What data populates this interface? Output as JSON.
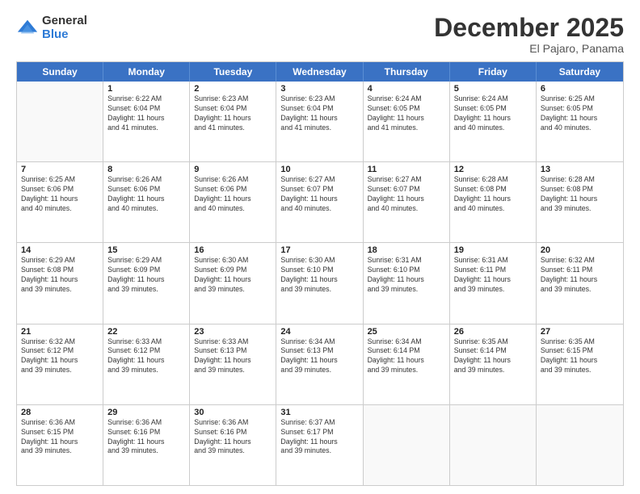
{
  "logo": {
    "general": "General",
    "blue": "Blue"
  },
  "title": "December 2025",
  "location": "El Pajaro, Panama",
  "days": [
    "Sunday",
    "Monday",
    "Tuesday",
    "Wednesday",
    "Thursday",
    "Friday",
    "Saturday"
  ],
  "weeks": [
    [
      {
        "day": "",
        "info": ""
      },
      {
        "day": "1",
        "info": "Sunrise: 6:22 AM\nSunset: 6:04 PM\nDaylight: 11 hours\nand 41 minutes."
      },
      {
        "day": "2",
        "info": "Sunrise: 6:23 AM\nSunset: 6:04 PM\nDaylight: 11 hours\nand 41 minutes."
      },
      {
        "day": "3",
        "info": "Sunrise: 6:23 AM\nSunset: 6:04 PM\nDaylight: 11 hours\nand 41 minutes."
      },
      {
        "day": "4",
        "info": "Sunrise: 6:24 AM\nSunset: 6:05 PM\nDaylight: 11 hours\nand 41 minutes."
      },
      {
        "day": "5",
        "info": "Sunrise: 6:24 AM\nSunset: 6:05 PM\nDaylight: 11 hours\nand 40 minutes."
      },
      {
        "day": "6",
        "info": "Sunrise: 6:25 AM\nSunset: 6:05 PM\nDaylight: 11 hours\nand 40 minutes."
      }
    ],
    [
      {
        "day": "7",
        "info": "Sunrise: 6:25 AM\nSunset: 6:06 PM\nDaylight: 11 hours\nand 40 minutes."
      },
      {
        "day": "8",
        "info": "Sunrise: 6:26 AM\nSunset: 6:06 PM\nDaylight: 11 hours\nand 40 minutes."
      },
      {
        "day": "9",
        "info": "Sunrise: 6:26 AM\nSunset: 6:06 PM\nDaylight: 11 hours\nand 40 minutes."
      },
      {
        "day": "10",
        "info": "Sunrise: 6:27 AM\nSunset: 6:07 PM\nDaylight: 11 hours\nand 40 minutes."
      },
      {
        "day": "11",
        "info": "Sunrise: 6:27 AM\nSunset: 6:07 PM\nDaylight: 11 hours\nand 40 minutes."
      },
      {
        "day": "12",
        "info": "Sunrise: 6:28 AM\nSunset: 6:08 PM\nDaylight: 11 hours\nand 40 minutes."
      },
      {
        "day": "13",
        "info": "Sunrise: 6:28 AM\nSunset: 6:08 PM\nDaylight: 11 hours\nand 39 minutes."
      }
    ],
    [
      {
        "day": "14",
        "info": "Sunrise: 6:29 AM\nSunset: 6:08 PM\nDaylight: 11 hours\nand 39 minutes."
      },
      {
        "day": "15",
        "info": "Sunrise: 6:29 AM\nSunset: 6:09 PM\nDaylight: 11 hours\nand 39 minutes."
      },
      {
        "day": "16",
        "info": "Sunrise: 6:30 AM\nSunset: 6:09 PM\nDaylight: 11 hours\nand 39 minutes."
      },
      {
        "day": "17",
        "info": "Sunrise: 6:30 AM\nSunset: 6:10 PM\nDaylight: 11 hours\nand 39 minutes."
      },
      {
        "day": "18",
        "info": "Sunrise: 6:31 AM\nSunset: 6:10 PM\nDaylight: 11 hours\nand 39 minutes."
      },
      {
        "day": "19",
        "info": "Sunrise: 6:31 AM\nSunset: 6:11 PM\nDaylight: 11 hours\nand 39 minutes."
      },
      {
        "day": "20",
        "info": "Sunrise: 6:32 AM\nSunset: 6:11 PM\nDaylight: 11 hours\nand 39 minutes."
      }
    ],
    [
      {
        "day": "21",
        "info": "Sunrise: 6:32 AM\nSunset: 6:12 PM\nDaylight: 11 hours\nand 39 minutes."
      },
      {
        "day": "22",
        "info": "Sunrise: 6:33 AM\nSunset: 6:12 PM\nDaylight: 11 hours\nand 39 minutes."
      },
      {
        "day": "23",
        "info": "Sunrise: 6:33 AM\nSunset: 6:13 PM\nDaylight: 11 hours\nand 39 minutes."
      },
      {
        "day": "24",
        "info": "Sunrise: 6:34 AM\nSunset: 6:13 PM\nDaylight: 11 hours\nand 39 minutes."
      },
      {
        "day": "25",
        "info": "Sunrise: 6:34 AM\nSunset: 6:14 PM\nDaylight: 11 hours\nand 39 minutes."
      },
      {
        "day": "26",
        "info": "Sunrise: 6:35 AM\nSunset: 6:14 PM\nDaylight: 11 hours\nand 39 minutes."
      },
      {
        "day": "27",
        "info": "Sunrise: 6:35 AM\nSunset: 6:15 PM\nDaylight: 11 hours\nand 39 minutes."
      }
    ],
    [
      {
        "day": "28",
        "info": "Sunrise: 6:36 AM\nSunset: 6:15 PM\nDaylight: 11 hours\nand 39 minutes."
      },
      {
        "day": "29",
        "info": "Sunrise: 6:36 AM\nSunset: 6:16 PM\nDaylight: 11 hours\nand 39 minutes."
      },
      {
        "day": "30",
        "info": "Sunrise: 6:36 AM\nSunset: 6:16 PM\nDaylight: 11 hours\nand 39 minutes."
      },
      {
        "day": "31",
        "info": "Sunrise: 6:37 AM\nSunset: 6:17 PM\nDaylight: 11 hours\nand 39 minutes."
      },
      {
        "day": "",
        "info": ""
      },
      {
        "day": "",
        "info": ""
      },
      {
        "day": "",
        "info": ""
      }
    ]
  ]
}
